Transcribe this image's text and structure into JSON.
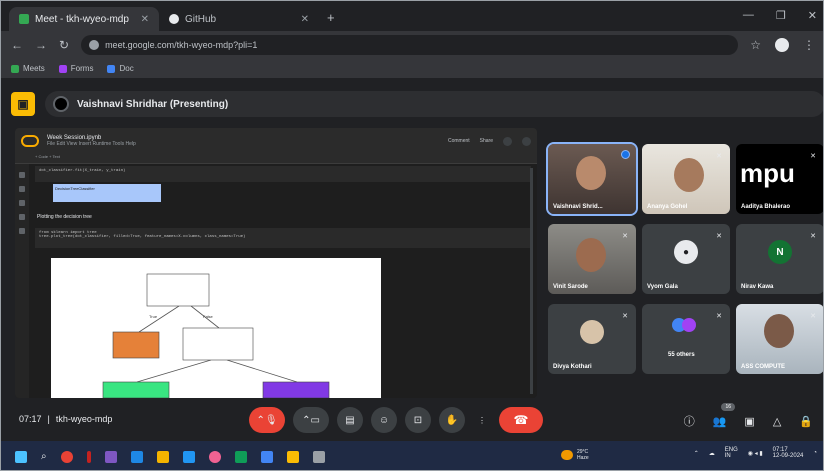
{
  "browser": {
    "tabs": [
      {
        "label": "Meet - tkh-wyeo-mdp",
        "active": true
      },
      {
        "label": "GitHub",
        "active": false
      }
    ],
    "new_tab": "+",
    "url": "meet.google.com/tkh-wyeo-mdp?pli=1",
    "bookmarks": [
      {
        "label": "Meets",
        "color": "#34a853"
      },
      {
        "label": "Forms",
        "color": "#a142f4"
      },
      {
        "label": "Doc",
        "color": "#4285f4"
      }
    ]
  },
  "meet": {
    "presenter": "Vaishnavi Shridhar (Presenting)",
    "meeting_time": "07:17",
    "meeting_code": "tkh-wyeo-mdp",
    "participant_badge": "16"
  },
  "colab": {
    "notebook_title": "Week Session.ipynb",
    "menu": "File  Edit  View  Insert  Runtime  Tools  Help",
    "actions": [
      "Comment",
      "Share"
    ],
    "code1": "dot_classifier.fit(X_train, y_train)",
    "chip": "DecisionTreeClassifier",
    "section": "Plotting the decision tree",
    "code2": "from sklearn import tree",
    "code3": "tree.plot_tree(dot_classifier, filled=True, feature_names=X.columns, class_names=True)",
    "edge_labels": [
      "True",
      "False"
    ]
  },
  "participants": [
    {
      "name": "Vaishnavi Shrid...",
      "active": true
    },
    {
      "name": "Ananya Gohel"
    },
    {
      "name": "Aaditya Bhalerao"
    },
    {
      "name": "Vinit Sarode"
    },
    {
      "name": "Vyom Gala",
      "initial": ""
    },
    {
      "name": "Nirav Kawa",
      "initial": "N"
    },
    {
      "name": "Divya Kothari"
    },
    {
      "name": "55 others"
    },
    {
      "name": "ASS COMPUTE"
    }
  ],
  "tile_brand": "mpu",
  "taskbar": {
    "weather_temp": "29°C",
    "weather_desc": "Haze",
    "lang_top": "ENG",
    "lang_bottom": "IN",
    "time": "07:17",
    "date": "12-09-2024"
  },
  "colors": {
    "accent": "#8ab4f8",
    "hangup": "#ea4335",
    "meet_logo": "#fbbc04"
  }
}
